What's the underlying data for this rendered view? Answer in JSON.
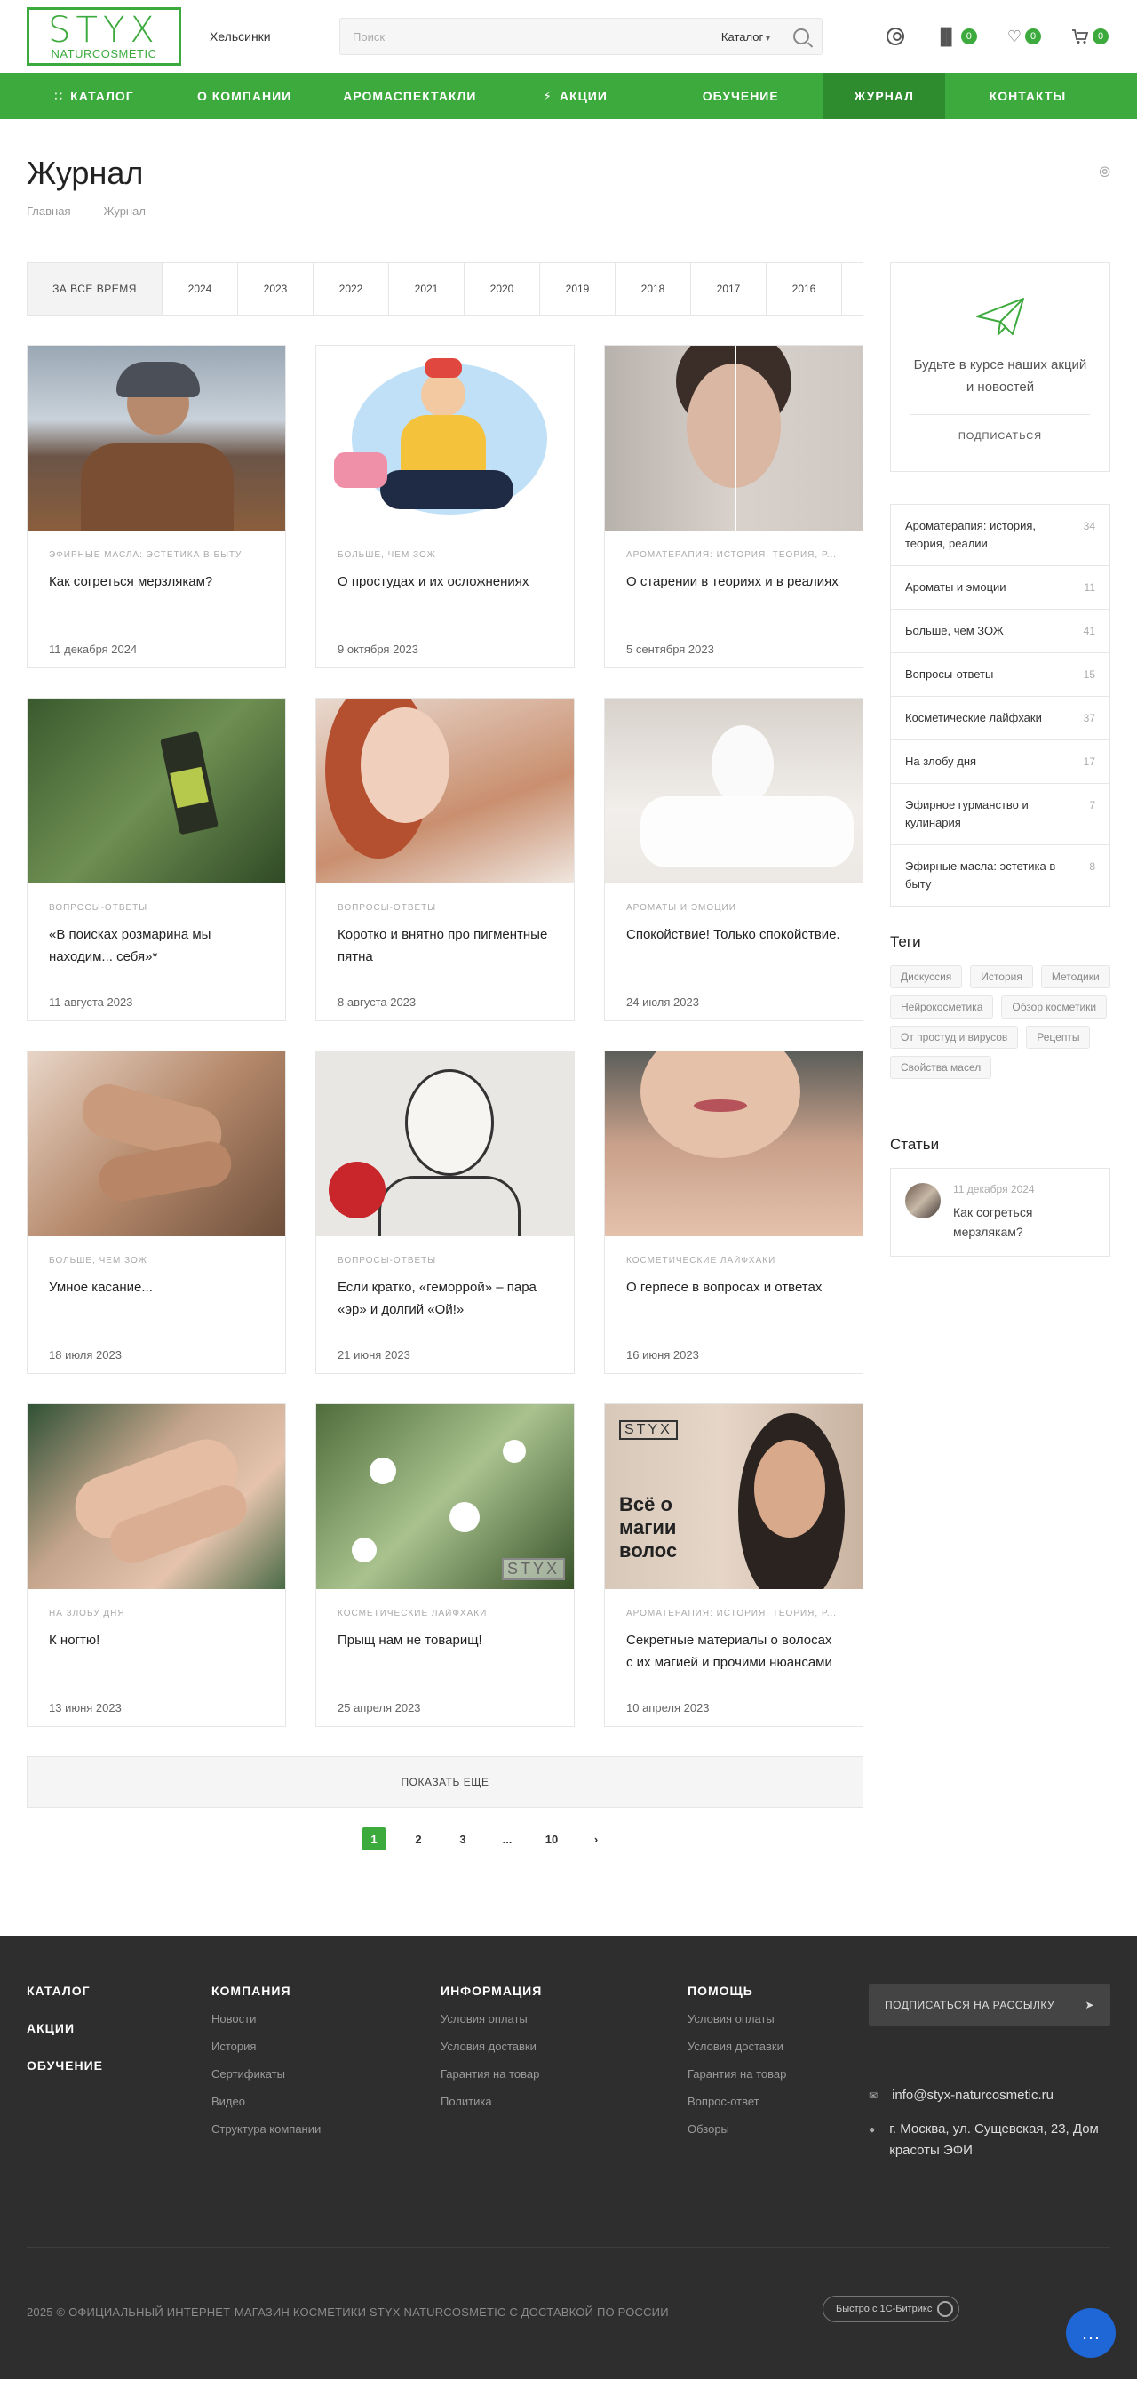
{
  "header": {
    "logo_top": "STYX",
    "logo_bottom": "NATURCOSMETIC",
    "city": "Хельсинки",
    "search_placeholder": "Поиск",
    "search_catalog": "Каталог",
    "compare_count": "0",
    "favorites_count": "0",
    "cart_count": "0"
  },
  "nav": {
    "items": [
      {
        "label": "КАТАЛОГ"
      },
      {
        "label": "О КОМПАНИИ"
      },
      {
        "label": "АРОМАСПЕКТАКЛИ"
      },
      {
        "label": "АКЦИИ"
      },
      {
        "label": "ОБУЧЕНИЕ"
      },
      {
        "label": "ЖУРНАЛ"
      },
      {
        "label": "КОНТАКТЫ"
      }
    ]
  },
  "page": {
    "title": "Журнал",
    "breadcrumbs": [
      "Главная",
      "—",
      "Журнал"
    ]
  },
  "years": [
    "ЗА ВСЕ ВРЕМЯ",
    "2024",
    "2023",
    "2022",
    "2021",
    "2020",
    "2019",
    "2018",
    "2017",
    "2016"
  ],
  "cards": [
    {
      "category": "ЭФИРНЫЕ МАСЛА: ЭСТЕТИКА В БЫТУ",
      "title": "Как согреться мерзлякам?",
      "date": "11 декабря 2024"
    },
    {
      "category": "БОЛЬШЕ, ЧЕМ ЗОЖ",
      "title": "О простудах и их осложнениях",
      "date": "9 октября 2023"
    },
    {
      "category": "АРОМАТЕРАПИЯ: ИСТОРИЯ, ТЕОРИЯ, Р...",
      "title": "О старении в теориях и в реалиях",
      "date": "5 сентября 2023"
    },
    {
      "category": "ВОПРОСЫ-ОТВЕТЫ",
      "title": "«В поисках розмарина мы находим... себя»*",
      "date": "11 августа 2023"
    },
    {
      "category": "ВОПРОСЫ-ОТВЕТЫ",
      "title": "Коротко и внятно про пигментные пятна",
      "date": "8 августа 2023"
    },
    {
      "category": "АРОМАТЫ И ЭМОЦИИ",
      "title": "Спокойствие! Только спокойствие.",
      "date": "24 июля 2023"
    },
    {
      "category": "БОЛЬШЕ, ЧЕМ ЗОЖ",
      "title": "Умное касание...",
      "date": "18 июля 2023"
    },
    {
      "category": "ВОПРОСЫ-ОТВЕТЫ",
      "title": "Если кратко, «геморрой» – пара «эр» и долгий «Ой!»",
      "date": "21 июня 2023"
    },
    {
      "category": "КОСМЕТИЧЕСКИЕ ЛАЙФХАКИ",
      "title": "О герпесе в вопросах и ответах",
      "date": "16 июня 2023"
    },
    {
      "category": "НА ЗЛОБУ ДНЯ",
      "title": "К ногтю!",
      "date": "13 июня 2023"
    },
    {
      "category": "КОСМЕТИЧЕСКИЕ ЛАЙФХАКИ",
      "title": "Прыщ нам не товарищ!",
      "date": "25 апреля 2023"
    },
    {
      "category": "АРОМАТЕРАПИЯ: ИСТОРИЯ, ТЕОРИЯ, Р...",
      "title": "Секретные материалы о волосах с их магией и прочими нюансами",
      "date": "10 апреля 2023"
    }
  ],
  "image_text": {
    "watermark": "STYX",
    "promo_logo": "STYX",
    "promo_text": "Всё о магии волос"
  },
  "more_button": "ПОКАЗАТЬ ЕЩЕ",
  "pagination": [
    "1",
    "2",
    "3",
    "...",
    "10"
  ],
  "subscribe": {
    "text": "Будьте в курсе наших акций и новостей",
    "button": "ПОДПИСАТЬСЯ"
  },
  "categories": [
    {
      "name": "Ароматерапия: история, теория, реалии",
      "count": "34"
    },
    {
      "name": "Ароматы и эмоции",
      "count": "11"
    },
    {
      "name": "Больше, чем ЗОЖ",
      "count": "41"
    },
    {
      "name": "Вопросы-ответы",
      "count": "15"
    },
    {
      "name": "Косметические лайфхаки",
      "count": "37"
    },
    {
      "name": "На злобу дня",
      "count": "17"
    },
    {
      "name": "Эфирное гурманство и кулинария",
      "count": "7"
    },
    {
      "name": "Эфирные масла: эстетика в быту",
      "count": "8"
    }
  ],
  "tags_title": "Теги",
  "tags": [
    "Дискуссия",
    "История",
    "Методики",
    "Нейрокосметика",
    "Обзор косметики",
    "От простуд и вирусов",
    "Рецепты",
    "Свойства масел"
  ],
  "articles_title": "Статьи",
  "article": {
    "date": "11 декабря 2024",
    "title": "Как согреться мерзлякам?"
  },
  "footer": {
    "main_links": [
      "КАТАЛОГ",
      "АКЦИИ",
      "ОБУЧЕНИЕ"
    ],
    "company": {
      "title": "КОМПАНИЯ",
      "links": [
        "Новости",
        "История",
        "Сертификаты",
        "Видео",
        "Структура компании"
      ]
    },
    "info": {
      "title": "ИНФОРМАЦИЯ",
      "links": [
        "Условия оплаты",
        "Условия доставки",
        "Гарантия на товар",
        "Политика"
      ]
    },
    "help": {
      "title": "ПОМОЩЬ",
      "links": [
        "Условия оплаты",
        "Условия доставки",
        "Гарантия на товар",
        "Вопрос-ответ",
        "Обзоры"
      ]
    },
    "subscribe_button": "ПОДПИСАТЬСЯ НА РАССЫЛКУ",
    "email": "info@styx-naturcosmetic.ru",
    "address": "г. Москва, ул. Сущевская, 23, Дом красоты ЭФИ",
    "copyright": "2025 © ОФИЦИАЛЬНЫЙ ИНТЕРНЕТ-МАГАЗИН КОСМЕТИКИ STYX NATURCOSMETIC С ДОСТАВКОЙ ПО РОССИИ",
    "bitrix": "Быстро с 1С-Битрикс"
  },
  "colors": {
    "accent": "#3daa3d",
    "accent_dark": "#2e8b2e",
    "footer_bg": "#2e2e2e",
    "chat": "#1f66d6"
  },
  "icons": [
    "search-icon",
    "user-icon",
    "compare-icon",
    "heart-icon",
    "cart-icon",
    "rss-icon",
    "paper-plane-icon",
    "mail-icon",
    "location-icon",
    "chevron-right-icon",
    "chat-icon"
  ]
}
